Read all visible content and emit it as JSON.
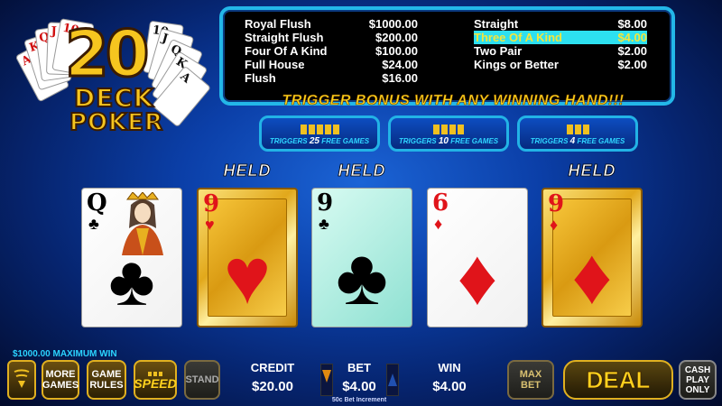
{
  "logo": {
    "number": "20",
    "line1": "DECK",
    "line2": "POKER",
    "fan_left": [
      "A",
      "K",
      "Q",
      "J",
      "10"
    ],
    "fan_right": [
      "10",
      "J",
      "Q",
      "K",
      "A"
    ]
  },
  "paytable": {
    "left": [
      {
        "hand": "Royal Flush",
        "pay": "$1000.00"
      },
      {
        "hand": "Straight Flush",
        "pay": "$200.00"
      },
      {
        "hand": "Four Of A Kind",
        "pay": "$100.00"
      },
      {
        "hand": "Full House",
        "pay": "$24.00"
      },
      {
        "hand": "Flush",
        "pay": "$16.00"
      }
    ],
    "right": [
      {
        "hand": "Straight",
        "pay": "$8.00"
      },
      {
        "hand": "Three Of A Kind",
        "pay": "$4.00"
      },
      {
        "hand": "Two Pair",
        "pay": "$2.00"
      },
      {
        "hand": "Kings or Better",
        "pay": "$2.00"
      }
    ],
    "highlighted": "Three Of A Kind"
  },
  "trigger_text": "TRIGGER BONUS WITH ANY WINNING HAND!!!",
  "bonus": [
    {
      "prefix": "TRIGGERS",
      "count": "25",
      "suffix": "FREE GAMES",
      "squares": 5
    },
    {
      "prefix": "TRIGGERS",
      "count": "10",
      "suffix": "FREE GAMES",
      "squares": 4
    },
    {
      "prefix": "TRIGGERS",
      "count": "4",
      "suffix": "FREE GAMES",
      "squares": 3
    }
  ],
  "held_label": "HELD",
  "cards": [
    {
      "rank": "Q",
      "suit": "♣",
      "color": "black",
      "style": "white",
      "held": false,
      "face": true
    },
    {
      "rank": "9",
      "suit": "♥",
      "color": "red",
      "style": "gold",
      "held": true,
      "face": false
    },
    {
      "rank": "9",
      "suit": "♣",
      "color": "black",
      "style": "teal",
      "held": true,
      "face": false
    },
    {
      "rank": "6",
      "suit": "♦",
      "color": "red",
      "style": "white",
      "held": false,
      "face": false
    },
    {
      "rank": "9",
      "suit": "♦",
      "color": "red",
      "style": "gold",
      "held": true,
      "face": false
    }
  ],
  "bottom": {
    "max_win": "$1000.00 MAXIMUM WIN",
    "more_games": "MORE GAMES",
    "game_rules": "GAME RULES",
    "speed": "SPEED",
    "stand": "STAND",
    "credit_label": "CREDIT",
    "credit_value": "$20.00",
    "bet_label": "BET",
    "bet_value": "$4.00",
    "bet_increment": "50c Bet Increment",
    "win_label": "WIN",
    "win_value": "$4.00",
    "max_bet": "MAX BET",
    "deal": "DEAL",
    "cash_play_only": "CASH PLAY ONLY"
  },
  "colors": {
    "accent_cyan": "#23b7e8",
    "gold": "#ffd51a",
    "card_red": "#e0141a",
    "highlight": "#2de0f0"
  }
}
